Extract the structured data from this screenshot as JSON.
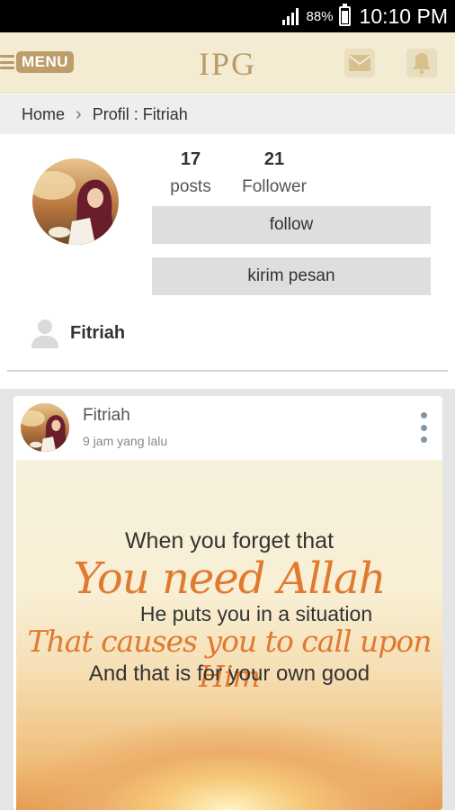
{
  "status_bar": {
    "battery_percent": "88%",
    "time": "10:10 PM",
    "icons": [
      "signal-icon",
      "battery-icon"
    ]
  },
  "app_bar": {
    "menu_label": "MENU",
    "brand": "IPG",
    "icons": [
      "hamburger-icon",
      "mail-icon",
      "bell-icon"
    ]
  },
  "breadcrumb": {
    "home": "Home",
    "current": "Profil : Fitriah"
  },
  "profile": {
    "stats": {
      "posts_count": "17",
      "posts_label": "posts",
      "followers_count": "21",
      "followers_label": "Follower"
    },
    "follow_label": "follow",
    "message_label": "kirim pesan",
    "name": "Fitriah"
  },
  "post": {
    "author": "Fitriah",
    "time": "9 jam yang lalu",
    "quote": {
      "line1": "When you forget that",
      "line2": "You need Allah",
      "line3": "He puts you in a situation",
      "line4": "That causes you to call upon Him",
      "line5": "And that is for your own good"
    }
  },
  "colors": {
    "app_bar_bg": "#f3ecd3",
    "brand_gold": "#b99b66",
    "menu_badge": "#bd9d6a",
    "button_grey": "#dedede",
    "quote_orange": "#e07a30"
  }
}
